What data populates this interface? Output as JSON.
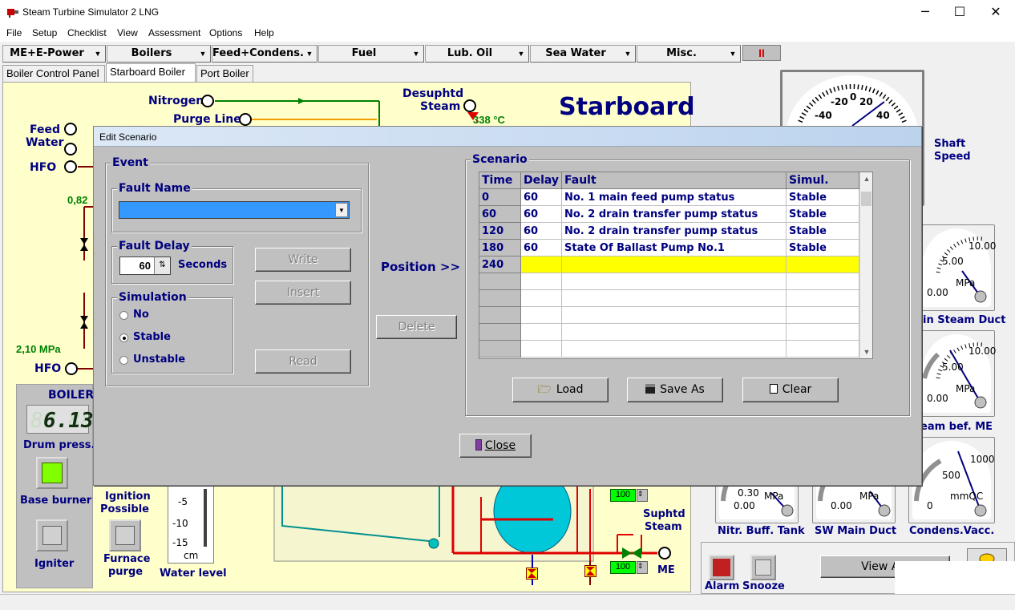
{
  "window": {
    "title": "Steam Turbine Simulator 2 LNG",
    "controls": {
      "minimize": "─",
      "maximize": "☐",
      "close": "✕"
    }
  },
  "menu": [
    "File",
    "Setup",
    "Checklist",
    "View",
    "Assessment",
    "Options",
    "Help"
  ],
  "toolbar": {
    "combos": [
      "ME+E-Power",
      "Boilers",
      "Feed+Condens.",
      "Fuel",
      "Lub. Oil",
      "Sea Water",
      "Misc."
    ],
    "pause_label": "II"
  },
  "tabs": [
    "Boiler Control Panel",
    "Starboard Boiler",
    "Port Boiler"
  ],
  "panel": {
    "heading": "Starboard",
    "nitrogen": "Nitrogen",
    "purge_line": "Purge Line",
    "desuphtd_steam": [
      "Desuphtd",
      "Steam"
    ],
    "desuphtd_temp": "338 °C",
    "feed_water": [
      "Feed",
      "Water"
    ],
    "hfo_top": "HFO",
    "hfo_bottom": "HFO",
    "val_082": "0,82",
    "val_210": "2,10 MPa",
    "boiler_label": "BOILER",
    "drum_press_value": "6.13",
    "drum_press_ghost": "88.88",
    "drum_press_label": "Drum press.",
    "base_burner": "Base burner",
    "ignition_possible": [
      "Ignition",
      "Possible"
    ],
    "igniter": "Igniter",
    "furnace_purge": [
      "Furnace",
      "purge"
    ],
    "water_level": "Water level",
    "water_ticks": [
      "-5",
      "-10",
      "-15"
    ],
    "water_unit": "cm",
    "valve_100_a": "100",
    "valve_100_b": "100",
    "suphtd_steam": [
      "Suphtd",
      "Steam"
    ],
    "me_label": "ME",
    "shaft_speed": [
      "Shaft",
      "Speed"
    ],
    "shaft_ticks": [
      "-20",
      "0",
      "20",
      "-40",
      "40"
    ],
    "gauges": [
      {
        "label": "in Steam Duct",
        "max": "10.00",
        "mid": "5.00",
        "min": "0.00",
        "unit": "MPa"
      },
      {
        "label": "eam bef. ME",
        "max": "10.00",
        "mid": "5.00",
        "min": "0.00",
        "unit": "MPa"
      },
      {
        "label": "Nitr. Buff. Tank",
        "max": "0.30",
        "min": "0.00",
        "unit": "MPa"
      },
      {
        "label": "SW Main Duct",
        "min": "0.00",
        "unit": "MPa"
      },
      {
        "label": "Condens.Vacc.",
        "max": "1000",
        "mid": "500",
        "min": "0",
        "unit": "mmQC"
      }
    ],
    "alarm": "Alarm",
    "snooze": "Snooze",
    "view_alarms": "View Ala"
  },
  "dialog": {
    "title": "Edit Scenario",
    "event_legend": "Event",
    "fault_name_legend": "Fault Name",
    "fault_name_value": "",
    "fault_delay_legend": "Fault Delay",
    "fault_delay_value": "60",
    "seconds": "Seconds",
    "simulation_legend": "Simulation",
    "sim_options": [
      "No",
      "Stable",
      "Unstable"
    ],
    "sim_selected": "Stable",
    "write": "Write",
    "insert": "Insert",
    "read": "Read",
    "position": "Position >>",
    "delete": "Delete",
    "scenario_legend": "Scenario",
    "columns": [
      "Time",
      "Delay",
      "Fault",
      "Simul."
    ],
    "rows": [
      [
        "0",
        "60",
        "No. 1 main feed pump status",
        "Stable"
      ],
      [
        "60",
        "60",
        "No. 2 drain transfer pump status",
        "Stable"
      ],
      [
        "120",
        "60",
        "No. 2 drain transfer pump status",
        "Stable"
      ],
      [
        "180",
        "60",
        "State Of Ballast Pump No.1",
        "Stable"
      ],
      [
        "240",
        "",
        "",
        ""
      ]
    ],
    "load": "Load",
    "save_as": "Save As",
    "clear": "Clear",
    "close": "Close",
    "highlight_color": "#ffff00",
    "selection_color": "#3399ff"
  }
}
